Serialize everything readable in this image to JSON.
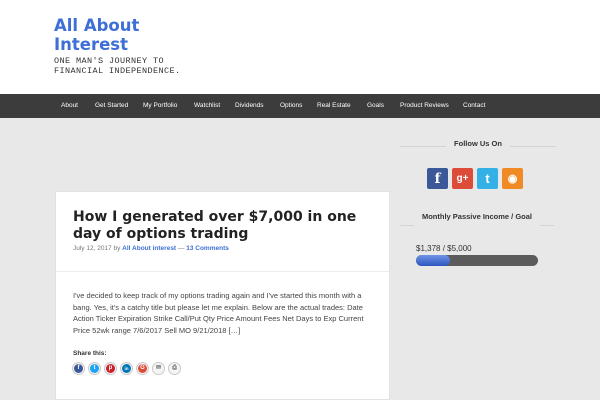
{
  "site": {
    "title": "All About Interest",
    "tagline": "ONE MAN'S JOURNEY TO FINANCIAL INDEPENDENCE."
  },
  "nav": {
    "items": [
      {
        "label": "About"
      },
      {
        "label": "Get Started"
      },
      {
        "label": "My Portfolio"
      },
      {
        "label": "Watchlist"
      },
      {
        "label": "Dividends"
      },
      {
        "label": "Options"
      },
      {
        "label": "Real Estate"
      },
      {
        "label": "Goals"
      },
      {
        "label": "Product Reviews"
      },
      {
        "label": "Contact"
      }
    ]
  },
  "post": {
    "title": "How I generated over $7,000 in one day of options trading",
    "date": "July 12, 2017",
    "by": "by",
    "author": "All About interest",
    "separator": "—",
    "comments": "13 Comments",
    "excerpt": "I've decided to keep track of my options trading again and I've started this month with a bang.  Yes, it's a catchy title but please let me explain. Below are the actual trades: Date Action Ticker Expiration Strike Call/Put Qty Price Amount Fees Net Days to Exp Current Price 52wk range 7/6/2017 Sell MO 9/21/2018 […]",
    "share_label": "Share this:",
    "share_buttons": [
      {
        "icon": "facebook-icon",
        "glyph": "f",
        "color": "#3b5998"
      },
      {
        "icon": "twitter-icon",
        "glyph": "t",
        "color": "#1da1f2"
      },
      {
        "icon": "pinterest-icon",
        "glyph": "p",
        "color": "#cb2027"
      },
      {
        "icon": "linkedin-icon",
        "glyph": "in",
        "color": "#0077b5"
      },
      {
        "icon": "google-plus-icon",
        "glyph": "G",
        "color": "#dd4b39"
      },
      {
        "icon": "email-icon",
        "glyph": "✉",
        "color": "#8a8a8a"
      },
      {
        "icon": "print-icon",
        "glyph": "⎙",
        "color": "#8a8a8a"
      }
    ]
  },
  "sidebar": {
    "follow_heading": "Follow Us On",
    "social": [
      {
        "icon": "facebook-icon",
        "glyph": "f",
        "color": "#3b5998"
      },
      {
        "icon": "google-plus-icon",
        "glyph": "g+",
        "color": "#dd4b39"
      },
      {
        "icon": "twitter-icon",
        "glyph": "t",
        "color": "#33b1e6"
      },
      {
        "icon": "rss-icon",
        "glyph": "◉",
        "color": "#f08a24"
      }
    ],
    "income_heading": "Monthly Passive Income / Goal",
    "income_text": "$1,378 / $5,000",
    "income_current": 1378,
    "income_goal": 5000
  }
}
